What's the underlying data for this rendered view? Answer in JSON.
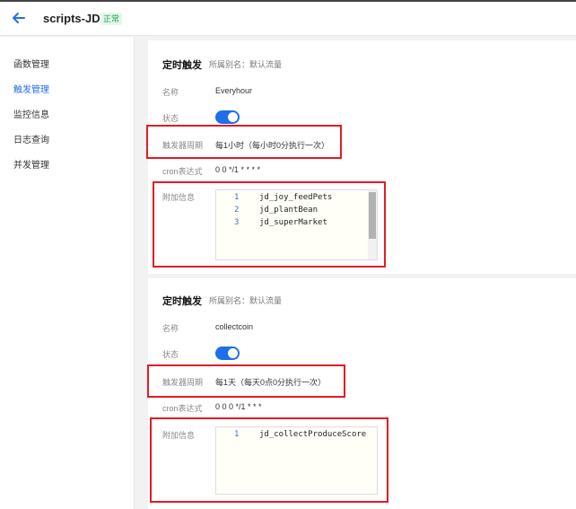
{
  "header": {
    "title": "scripts-JD",
    "status": "正常"
  },
  "sidebar": {
    "items": [
      {
        "label": "函数管理",
        "active": false
      },
      {
        "label": "触发管理",
        "active": true
      },
      {
        "label": "监控信息",
        "active": false
      },
      {
        "label": "日志查询",
        "active": false
      },
      {
        "label": "并发管理",
        "active": false
      }
    ]
  },
  "labels": {
    "name": "名称",
    "state": "状态",
    "period": "触发器周期",
    "cron": "cron表达式",
    "extra": "附加信息"
  },
  "cards": [
    {
      "title": "定时触发",
      "alias": "所属别名：默认流量",
      "name": "Everyhour",
      "enabled": true,
      "period": "每1小时（每小时0分执行一次）",
      "cron": "0 0 */1 * * * *",
      "extra_lines": [
        {
          "no": "1",
          "text": "jd_joy_feedPets"
        },
        {
          "no": "2",
          "text": "jd_plantBean"
        },
        {
          "no": "3",
          "text": "jd_superMarket"
        }
      ]
    },
    {
      "title": "定时触发",
      "alias": "所属别名：默认流量",
      "name": "collectcoin",
      "enabled": true,
      "period": "每1天（每天0点0分执行一次）",
      "cron": "0 0 0 */1 * * *",
      "extra_lines": [
        {
          "no": "1",
          "text": "jd_collectProduceScore"
        }
      ]
    }
  ],
  "colors": {
    "accent": "#1f6feb",
    "highlight": "#e31b23",
    "status": "#1aa350"
  }
}
